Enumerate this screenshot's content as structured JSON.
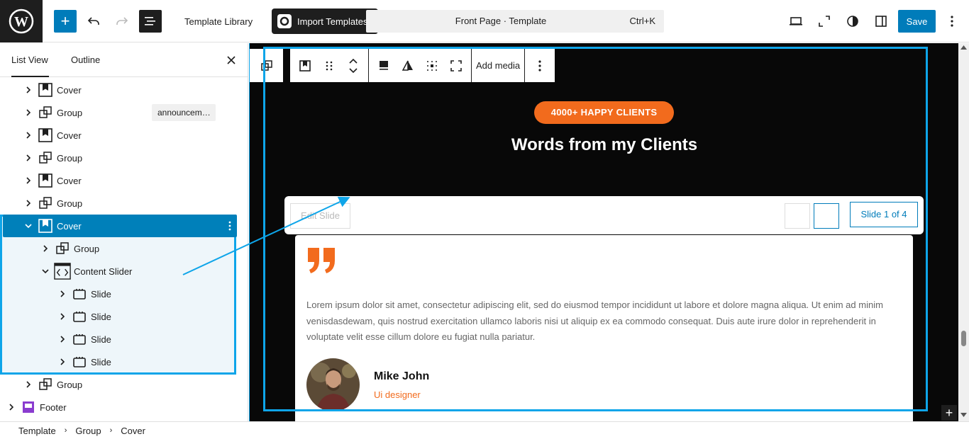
{
  "topbar": {
    "template_library": "Template Library",
    "import_templates": "Import Templates",
    "document_title": "Front Page · Template",
    "shortcut": "Ctrl+K",
    "save": "Save"
  },
  "sidebar": {
    "tabs": [
      "List View",
      "Outline"
    ],
    "annotation_badge": "announcem…",
    "tree": [
      {
        "label": "Cover",
        "type": "cover",
        "depth": 0,
        "expanded": false
      },
      {
        "label": "Group",
        "type": "group",
        "depth": 0,
        "expanded": false
      },
      {
        "label": "Cover",
        "type": "cover",
        "depth": 0,
        "expanded": false
      },
      {
        "label": "Group",
        "type": "group",
        "depth": 0,
        "expanded": false
      },
      {
        "label": "Cover",
        "type": "cover",
        "depth": 0,
        "expanded": false
      },
      {
        "label": "Group",
        "type": "group",
        "depth": 0,
        "expanded": false
      },
      {
        "label": "Cover",
        "type": "cover",
        "depth": 0,
        "expanded": true,
        "selected": true
      },
      {
        "label": "Group",
        "type": "group",
        "depth": 1,
        "expanded": false
      },
      {
        "label": "Content Slider",
        "type": "slider",
        "depth": 1,
        "expanded": true
      },
      {
        "label": "Slide",
        "type": "slide",
        "depth": 2,
        "expanded": false
      },
      {
        "label": "Slide",
        "type": "slide",
        "depth": 2,
        "expanded": false
      },
      {
        "label": "Slide",
        "type": "slide",
        "depth": 2,
        "expanded": false
      },
      {
        "label": "Slide",
        "type": "slide",
        "depth": 2,
        "expanded": false
      },
      {
        "label": "Group",
        "type": "group",
        "depth": 0,
        "expanded": false
      },
      {
        "label": "Footer",
        "type": "footer",
        "depth": -1,
        "expanded": false
      }
    ]
  },
  "toolbar": {
    "add_media": "Add media"
  },
  "canvas": {
    "pill": "4000+ HAPPY CLIENTS",
    "heading": "Words from my Clients",
    "edit_slide": "Edit Slide",
    "slide_counter": "Slide 1 of 4",
    "testimonial": "Lorem ipsum dolor sit amet, consectetur adipiscing elit, sed do eiusmod tempor incididunt ut labore et dolore magna aliqua. Ut enim ad minim venisdasdewam, quis nostrud exercitation ullamco laboris nisi ut aliquip ex ea commodo consequat. Duis aute irure dolor in reprehenderit in voluptate velit esse cillum dolore eu fugiat nulla pariatur.",
    "person_name": "Mike John",
    "person_role": "Ui designer"
  },
  "breadcrumb": [
    "Template",
    "Group",
    "Cover"
  ],
  "colors": {
    "accent": "#007cba",
    "orange": "#f26b1d",
    "highlight": "#0ea5e9",
    "selected_row": "#0080ba"
  }
}
